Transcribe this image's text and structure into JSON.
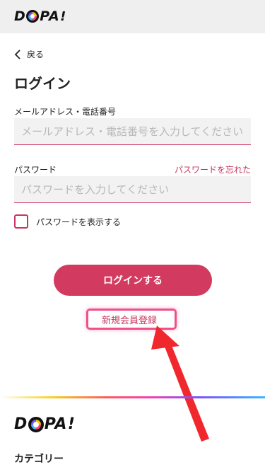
{
  "brand": {
    "logo_text": "DOPA!",
    "accent": "#d23a5f",
    "link_color": "#c8365f"
  },
  "nav": {
    "back_label": "戻る",
    "back_icon": "chevron-left-icon"
  },
  "page": {
    "title": "ログイン"
  },
  "form": {
    "email_label": "メールアドレス・電話番号",
    "email_placeholder": "メールアドレス・電話番号を入力してください",
    "email_value": "",
    "password_label": "パスワード",
    "password_placeholder": "パスワードを入力してください",
    "password_value": "",
    "forgot_label": "パスワードを忘れた",
    "show_password_label": "パスワードを表示する",
    "show_password_checked": false,
    "submit_label": "ログインする",
    "register_label": "新規会員登録"
  },
  "footer": {
    "logo_text": "DOPA!",
    "category_heading": "カテゴリー"
  },
  "annotation": {
    "highlight_color": "#f0508a",
    "arrow_color": "#f0282e"
  }
}
